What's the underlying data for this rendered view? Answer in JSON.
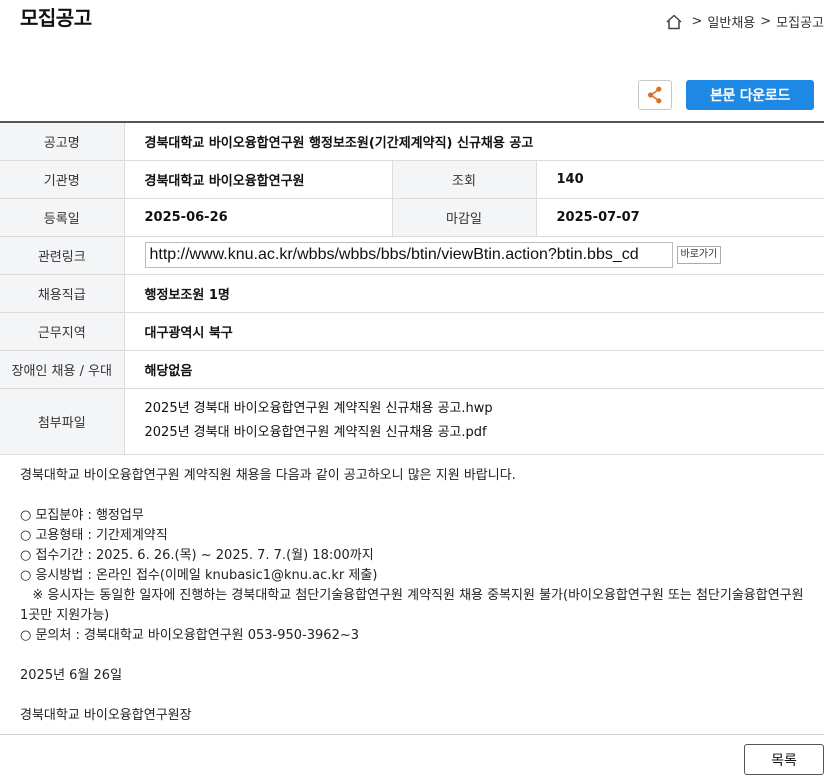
{
  "page_title": "모집공고",
  "breadcrumb": {
    "sep": ">",
    "items": [
      "일반채용",
      "모집공고"
    ]
  },
  "actions": {
    "download_label": "본문 다운로드"
  },
  "colors": {
    "accent": "#1e88e5",
    "share": "#e06d2b"
  },
  "table": {
    "title_label": "공고명",
    "title_value": "경북대학교 바이오융합연구원 행정보조원(기간제계약직) 신규채용 공고",
    "org_label": "기관명",
    "org_value": "경북대학교 바이오융합연구원",
    "views_label": "조회",
    "views_value": "140",
    "reg_label": "등록일",
    "reg_value": "2025-06-26",
    "deadline_label": "마감일",
    "deadline_value": "2025-07-07",
    "link_label": "관련링크",
    "link_value": "http://www.knu.ac.kr/wbbs/wbbs/bbs/btin/viewBtin.action?btin.bbs_cd",
    "link_go_label": "바로가기",
    "position_label": "채용직급",
    "position_value": "행정보조원 1명",
    "region_label": "근무지역",
    "region_value": "대구광역시 북구",
    "disabled_label": "장애인 채용 / 우대",
    "disabled_value": "해당없음",
    "attach_label": "첨부파일",
    "attachments": [
      "2025년 경북대 바이오융합연구원 계약직원 신규채용 공고.hwp",
      "2025년 경북대 바이오융합연구원 계약직원 신규채용 공고.pdf"
    ]
  },
  "content": {
    "intro": "경북대학교 바이오융합연구원 계약직원 채용을 다음과 같이 공고하오니 많은 지원 바랍니다.",
    "item1": "○ 모집분야 : 행정업무",
    "item2": "○ 고용형태 : 기간제계약직",
    "item3": "○ 접수기간 : 2025. 6. 26.(목) ~ 2025. 7. 7.(월) 18:00까지",
    "item4": "○ 응시방법 : 온라인 접수(이메일 knubasic1@knu.ac.kr 제출)",
    "note": "   ※ 응시자는 동일한 일자에 진행하는 경북대학교 첨단기술융합연구원 계약직원 채용 중복지원 불가(바이오융합연구원 또는 첨단기술융합연구원 1곳만 지원가능)",
    "item5": "○ 문의처 : 경북대학교 바이오융합연구원 053-950-3962~3",
    "date": "2025년 6월 26일",
    "signature": "경북대학교 바이오융합연구원장"
  },
  "footer": {
    "list_label": "목록"
  }
}
